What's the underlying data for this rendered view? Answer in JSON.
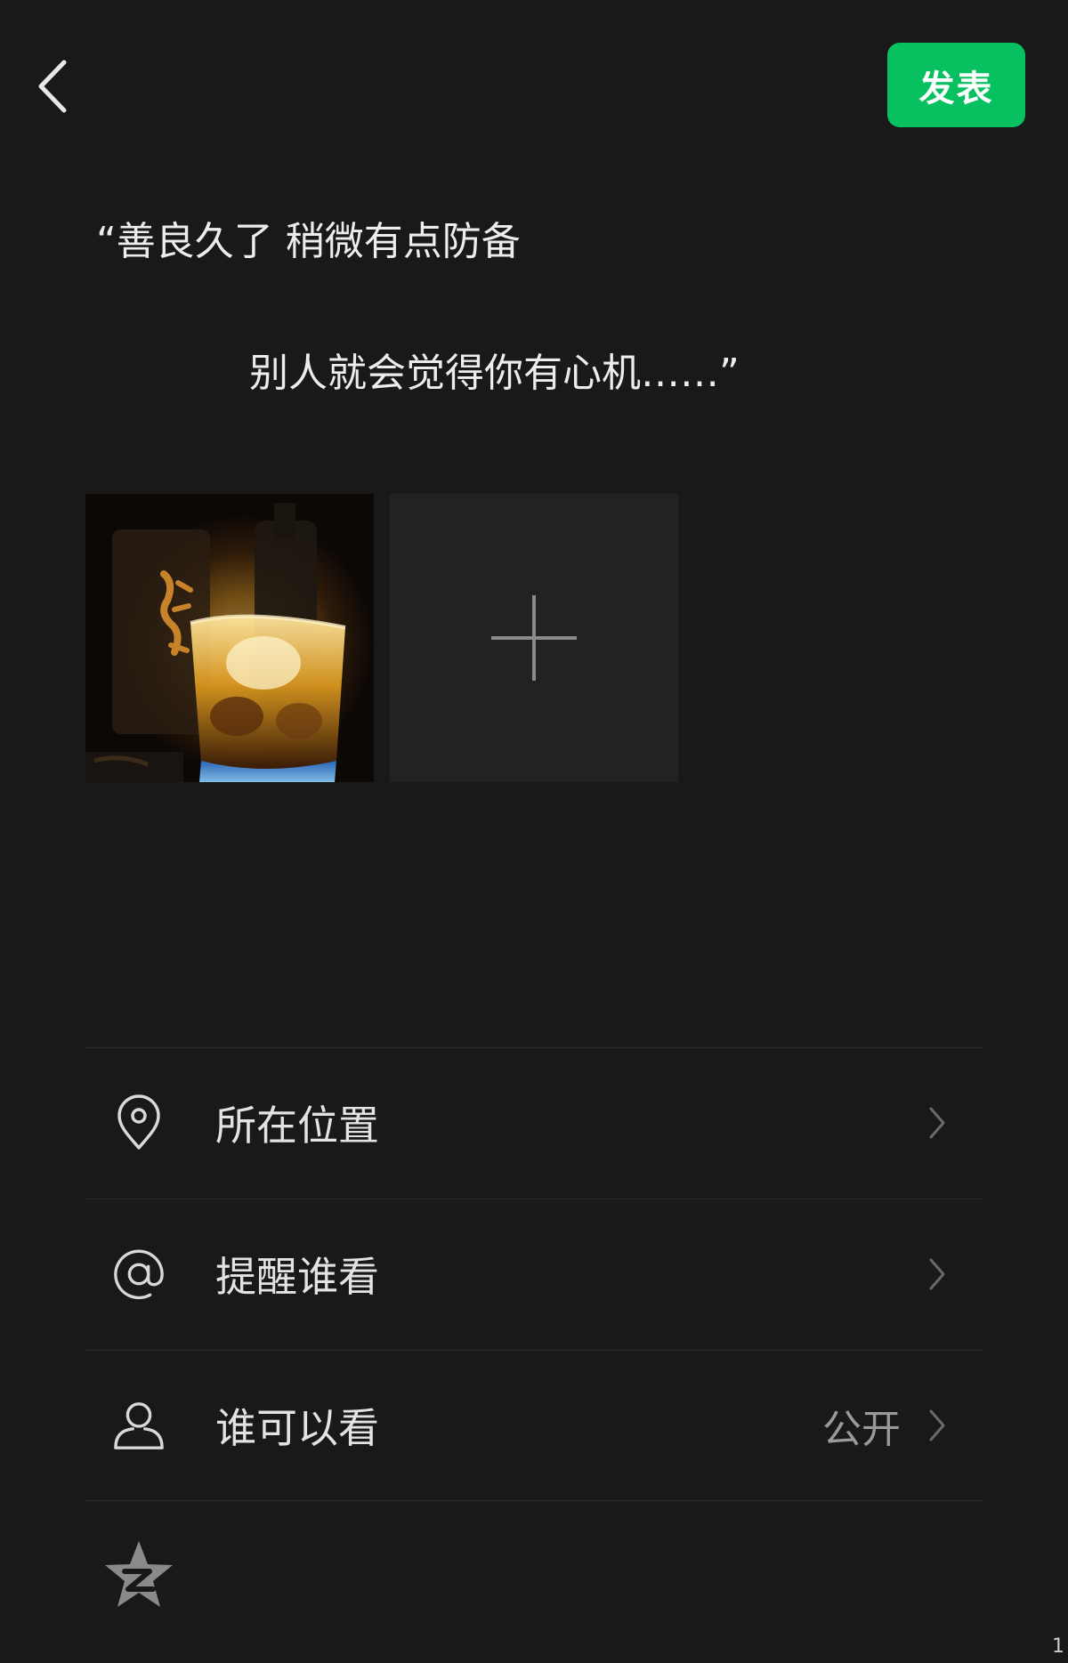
{
  "header": {
    "publish_label": "发表"
  },
  "post": {
    "line1": "“善良久了  稍微有点防备",
    "line2": "别人就会觉得你有心机……”"
  },
  "options": [
    {
      "label": "所在位置",
      "icon": "location-pin-icon",
      "value": ""
    },
    {
      "label": "提醒谁看",
      "icon": "at-sign-icon",
      "value": ""
    },
    {
      "label": "谁可以看",
      "icon": "person-icon",
      "value": "公开"
    }
  ],
  "footer": {
    "corner_text": "1"
  },
  "colors": {
    "background": "#191919",
    "accent": "#07c160",
    "text": "#e3e3e3",
    "secondary_text": "#9a9a9a"
  }
}
